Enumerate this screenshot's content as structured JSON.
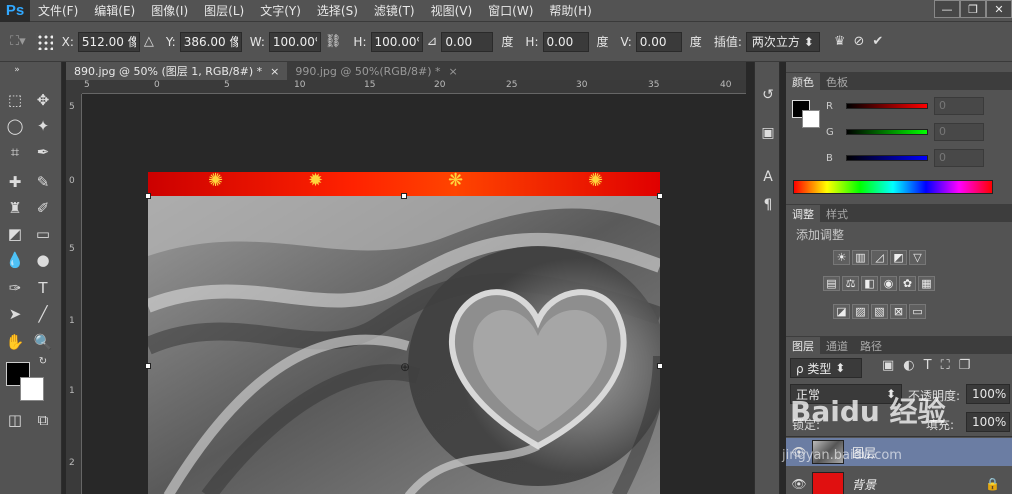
{
  "app": {
    "logo": "Ps"
  },
  "menu": [
    "文件(F)",
    "编辑(E)",
    "图像(I)",
    "图层(L)",
    "文字(Y)",
    "选择(S)",
    "滤镜(T)",
    "视图(V)",
    "窗口(W)",
    "帮助(H)"
  ],
  "options": {
    "x_label": "X:",
    "x_value": "512.00 像",
    "y_label": "Y:",
    "y_value": "386.00 像",
    "w_label": "W:",
    "w_value": "100.00%",
    "h_label": "H:",
    "h_value": "100.00%",
    "angle_value": "0.00",
    "angle_unit": "度",
    "hskew_label": "H:",
    "hskew_value": "0.00",
    "hskew_unit": "度",
    "vskew_label": "V:",
    "vskew_value": "0.00",
    "vskew_unit": "度",
    "interp_label": "插值:",
    "interp_value": "两次立方"
  },
  "tabs": [
    {
      "label": "890.jpg @ 50% (图层 1, RGB/8#) *",
      "close": "×",
      "active": true
    },
    {
      "label": "990.jpg @ 50%(RGB/8#) *",
      "close": "×",
      "active": false
    }
  ],
  "hruler_ticks": [
    "5",
    "0",
    "5",
    "10",
    "15",
    "20",
    "25",
    "30",
    "35",
    "40"
  ],
  "vruler_ticks": [
    "5",
    "0",
    "5",
    "1",
    "1",
    "2"
  ],
  "color_panel": {
    "tabs": [
      "颜色",
      "色板"
    ],
    "channels": [
      {
        "label": "R",
        "value": "0",
        "color": "#ff0000"
      },
      {
        "label": "G",
        "value": "0",
        "color": "#00ff00"
      },
      {
        "label": "B",
        "value": "0",
        "color": "#0000ff"
      }
    ]
  },
  "adjust_panel": {
    "tabs": [
      "调整",
      "样式"
    ],
    "title": "添加调整"
  },
  "layers_panel": {
    "tabs": [
      "图层",
      "通道",
      "路径"
    ],
    "filter_label": "ρ 类型",
    "blend_mode": "正常",
    "opacity_label": "不透明度:",
    "opacity_value": "100%",
    "lock_label": "锁定:",
    "fill_label": "填充:",
    "fill_value": "100%",
    "layers": [
      {
        "name": "图层",
        "selected": true
      },
      {
        "name": "背景",
        "selected": false
      }
    ]
  },
  "watermark": "Baidu 经验",
  "watermark_sub": "jingyan.baidu.com"
}
